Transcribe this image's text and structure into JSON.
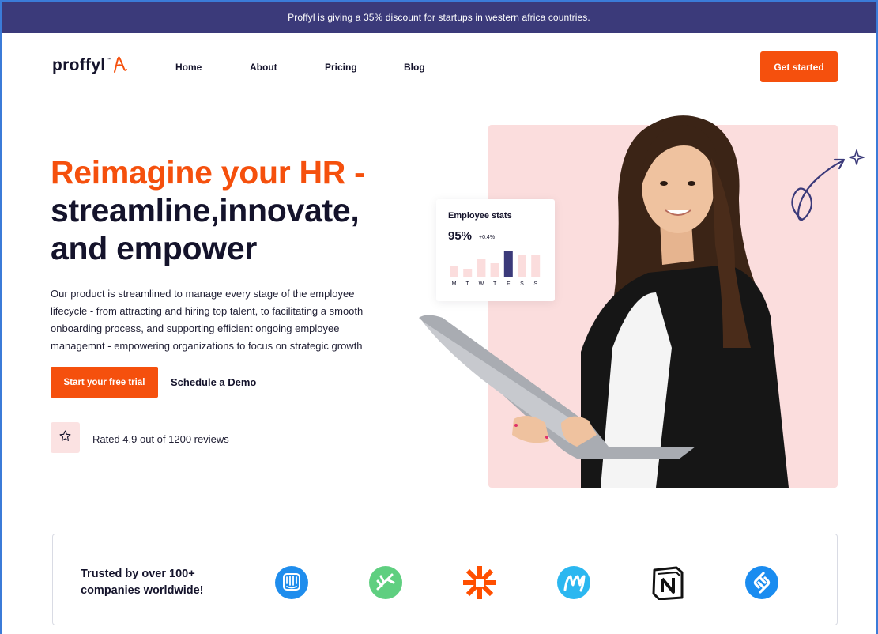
{
  "announcement": "Proffyl is giving a 35% discount for startups in western africa countries.",
  "brand": {
    "name": "proffyl",
    "tm": "™"
  },
  "nav": [
    {
      "label": "Home"
    },
    {
      "label": "About"
    },
    {
      "label": "Pricing"
    },
    {
      "label": "Blog"
    }
  ],
  "header": {
    "cta_label": "Get started"
  },
  "hero": {
    "title_accent": "Reimagine your HR -",
    "title_line2": "streamline,innovate,",
    "title_line3": "and empower",
    "description": "Our product is streamlined to manage every stage of the employee lifecycle - from attracting and hiring top talent, to facilitating a smooth onboarding process, and supporting efficient ongoing employee managemnt - empowering  organizations to focus on strategic growth",
    "primary_cta": "Start your free trial",
    "secondary_cta": "Schedule a Demo",
    "rating_text": "Rated 4.9 out of 1200 reviews"
  },
  "stats_card": {
    "title": "Employee stats",
    "value": "95%",
    "delta": "+0.4%",
    "days": [
      "M",
      "T",
      "W",
      "T",
      "F",
      "S",
      "S"
    ],
    "bar_levels": [
      0.35,
      0.25,
      0.6,
      0.45,
      0.85,
      0.7,
      0.7
    ],
    "highlight_index": 4
  },
  "trusted": {
    "text": "Trusted by over 100+ companies worldwide!",
    "logos": [
      "intercom-logo",
      "treehouse-logo",
      "zapier-logo",
      "miro-logo",
      "notion-logo",
      "shazam-logo"
    ]
  },
  "colors": {
    "accent": "#f5500d",
    "navy": "#3b3a7a",
    "dark_text": "#14132b",
    "pink_panel": "#fbdddd",
    "bar_light": "#fbdddd",
    "bar_highlight": "#3b3a7a"
  }
}
